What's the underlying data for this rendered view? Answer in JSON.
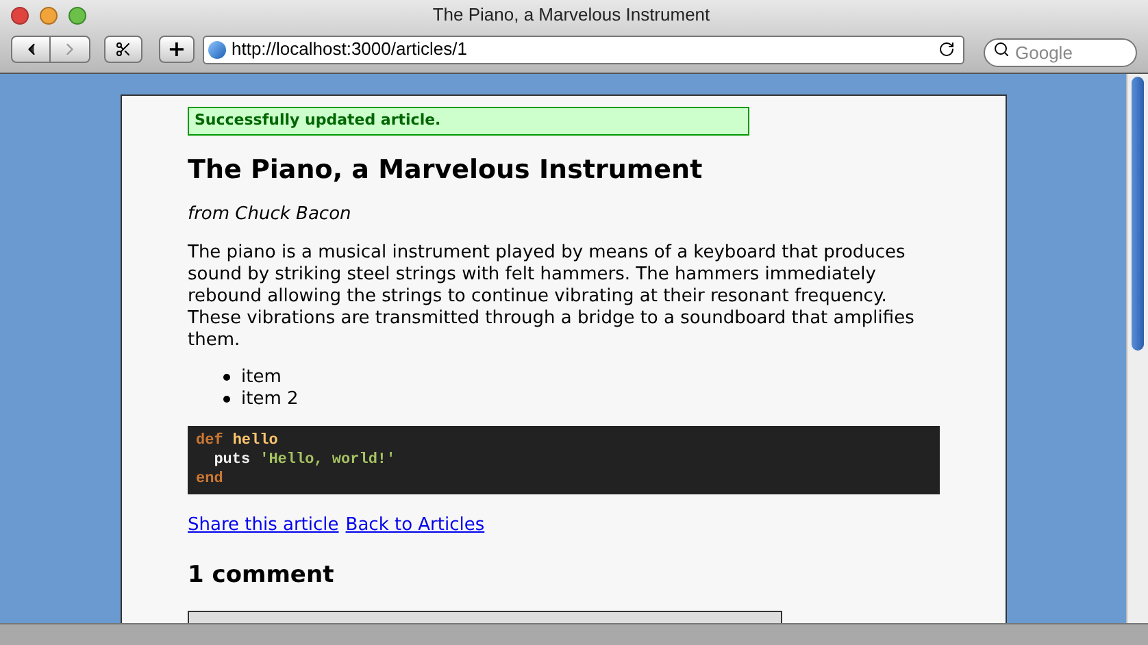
{
  "window": {
    "title": "The Piano, a Marvelous Instrument"
  },
  "toolbar": {
    "url": "http://localhost:3000/articles/1",
    "search": {
      "placeholder": "Google"
    },
    "add_button": "+"
  },
  "page": {
    "flash": "Successfully updated article.",
    "heading": "The Piano, a Marvelous Instrument",
    "byline": "from Chuck Bacon",
    "body": "The piano is a musical instrument played by means of a keyboard that produces sound by striking steel strings with felt hammers. The hammers immediately rebound allowing the strings to continue vibrating at their resonant frequency. These vibrations are transmitted through a bridge to a soundboard that amplifies them.",
    "list": [
      "item",
      "item 2"
    ],
    "code": [
      [
        {
          "kind": "keyword",
          "text": "def"
        },
        {
          "kind": "name",
          "text": "hello"
        }
      ],
      [
        {
          "kind": "plain",
          "text": "  puts"
        },
        {
          "kind": "string",
          "text": "'Hello, world!'"
        }
      ],
      [
        {
          "kind": "keyword",
          "text": "end"
        }
      ]
    ],
    "links": [
      "Share this article",
      "Back to Articles"
    ],
    "comments_heading": "1 comment"
  }
}
